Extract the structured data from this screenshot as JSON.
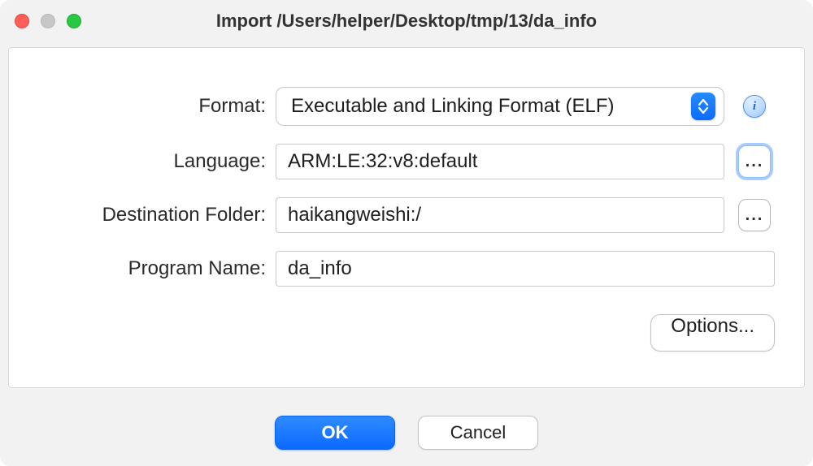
{
  "window": {
    "title": "Import /Users/helper/Desktop/tmp/13/da_info"
  },
  "labels": {
    "format": "Format:",
    "language": "Language:",
    "destination_folder": "Destination Folder:",
    "program_name": "Program Name:"
  },
  "fields": {
    "format": {
      "value": "Executable and Linking Format (ELF)"
    },
    "language": {
      "value": "ARM:LE:32:v8:default"
    },
    "destination_folder": {
      "value": "haikangweishi:/"
    },
    "program_name": {
      "value": "da_info"
    }
  },
  "buttons": {
    "options": "Options...",
    "ok": "OK",
    "cancel": "Cancel",
    "browse": "...",
    "info": "i"
  }
}
